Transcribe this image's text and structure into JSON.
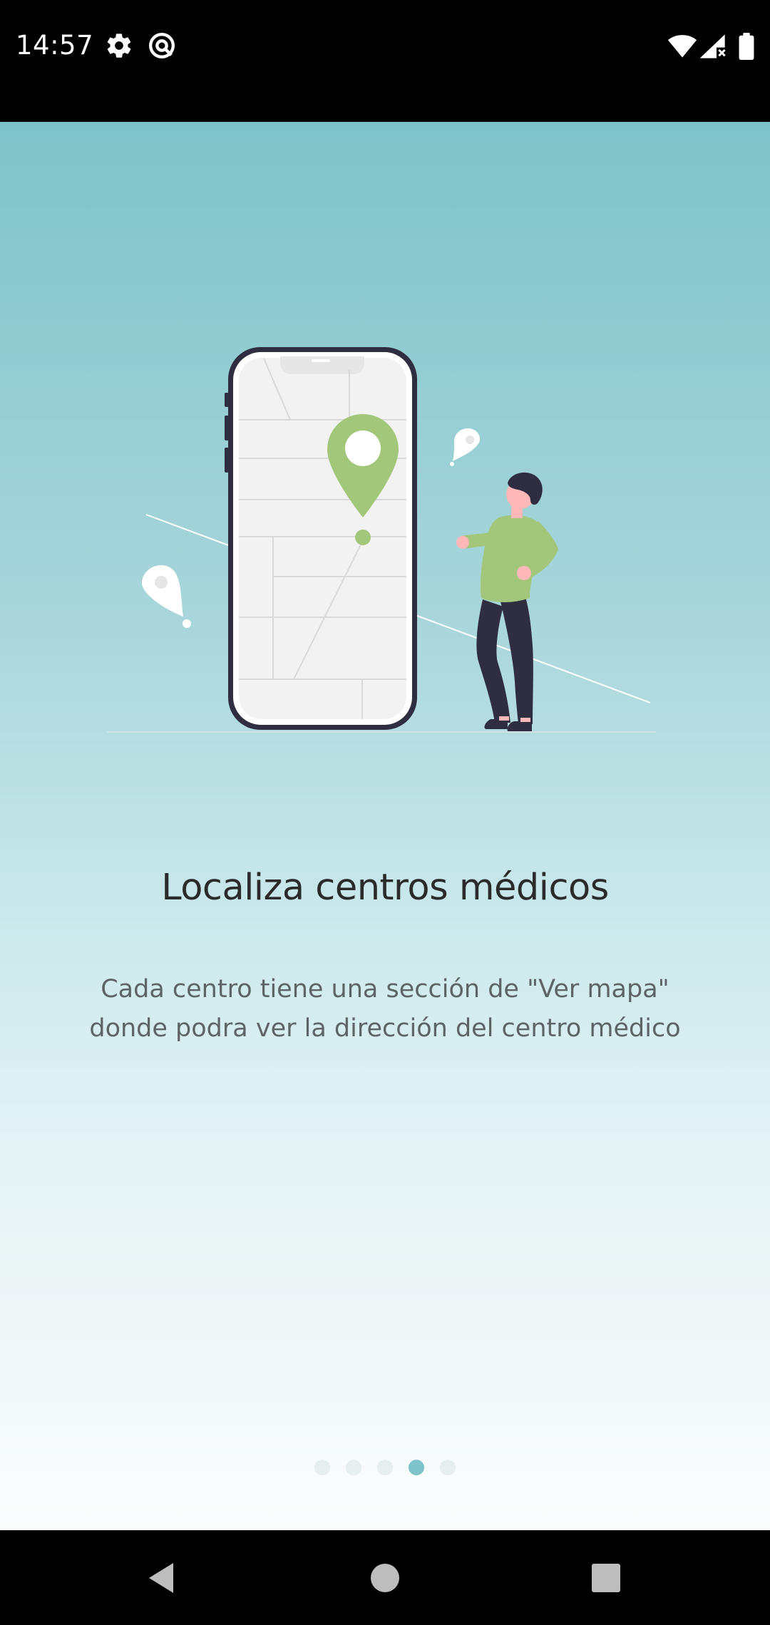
{
  "status_bar": {
    "time": "14:57",
    "icons": [
      "gear-icon",
      "sync-off-icon",
      "wifi-icon",
      "signal-icon",
      "battery-icon"
    ]
  },
  "onboarding": {
    "title": "Localiza centros médicos",
    "description_line1": "Cada centro tiene una sección de \"Ver mapa\"",
    "description_line2": "donde podra ver la dirección del centro médico",
    "pages_total": 5,
    "current_page": 4
  },
  "colors": {
    "accent": "#7ec3c9",
    "illustration_green": "#a3c77a",
    "dark": "#2f2e41"
  },
  "nav_bar": {
    "buttons": [
      "back",
      "home",
      "recents"
    ]
  }
}
